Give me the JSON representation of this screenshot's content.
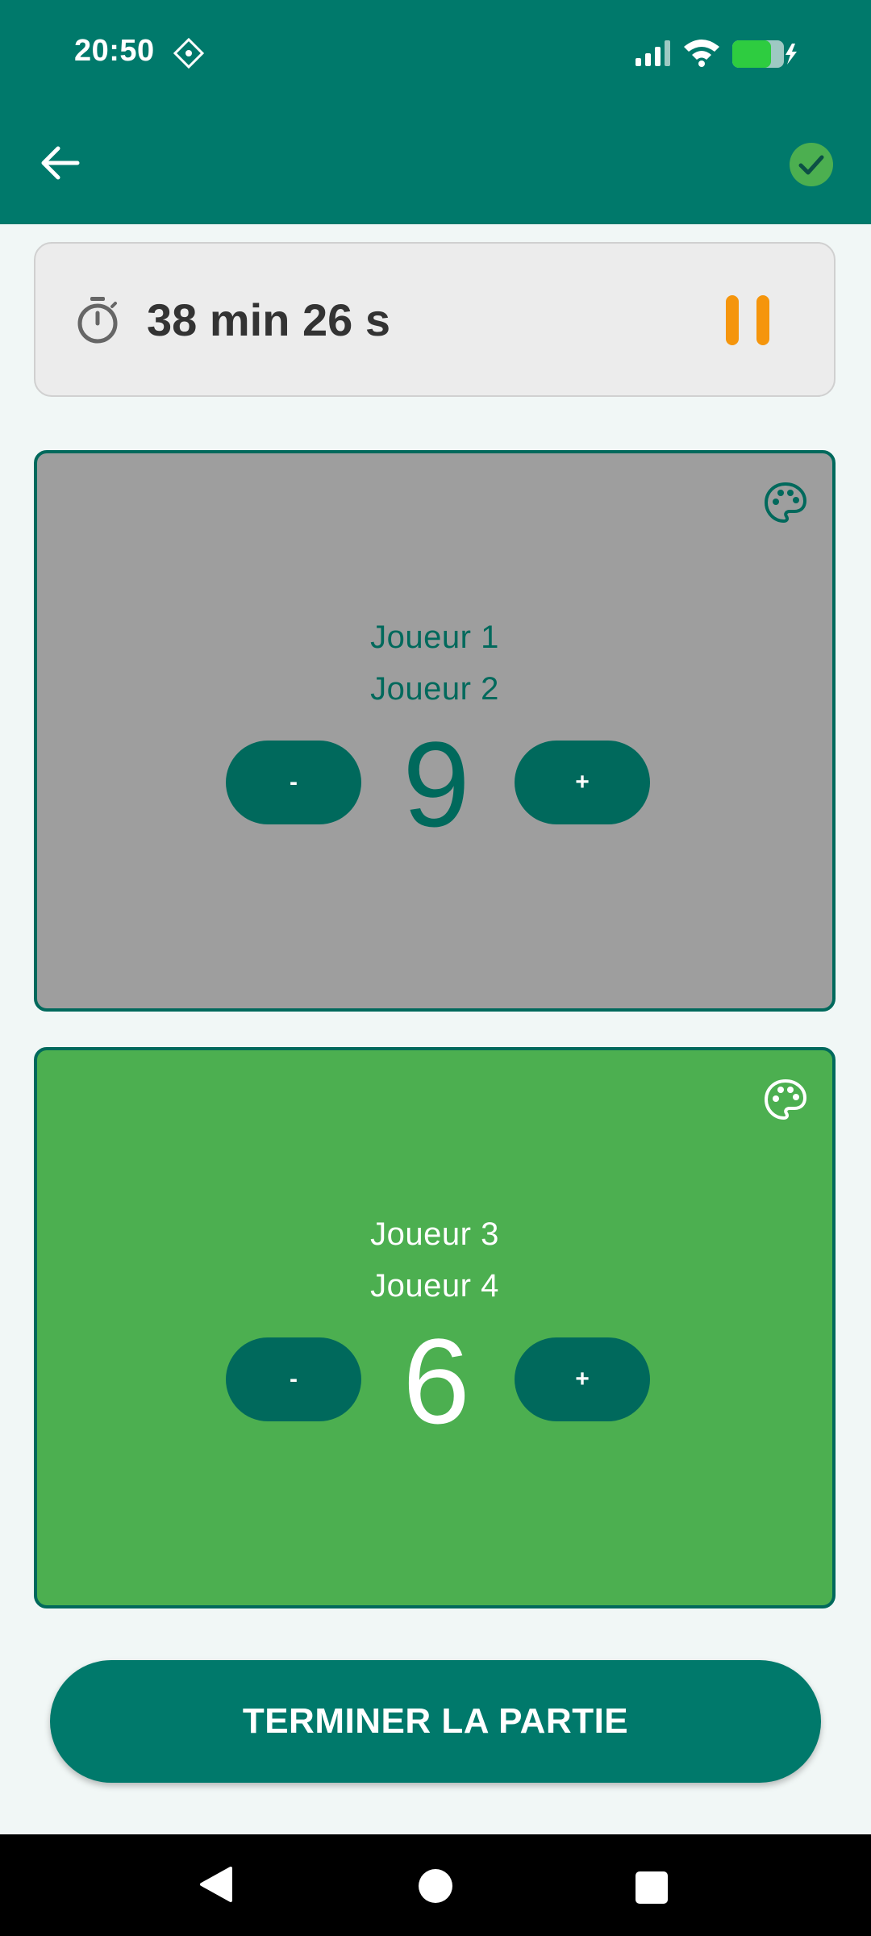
{
  "status_bar": {
    "time": "20:50",
    "icons": [
      "gps-icon",
      "signal-icon",
      "wifi-icon",
      "battery-charging-icon"
    ]
  },
  "app_bar": {
    "back_icon": "arrow-back-icon",
    "confirm_icon": "check-circle-icon"
  },
  "timer": {
    "icon": "stopwatch-icon",
    "elapsed": "38 min 26 s",
    "pause_icon": "pause-icon",
    "pause_color": "#f5950c"
  },
  "teams": [
    {
      "players": [
        "Joueur 1",
        "Joueur 2"
      ],
      "score": "9",
      "minus_label": "-",
      "plus_label": "+",
      "background": "#9e9e9e",
      "text_color": "#00695c",
      "palette_icon": "palette-icon"
    },
    {
      "players": [
        "Joueur 3",
        "Joueur 4"
      ],
      "score": "6",
      "minus_label": "-",
      "plus_label": "+",
      "background": "#4caf50",
      "text_color": "#ffffff",
      "palette_icon": "palette-icon"
    }
  ],
  "finish_button": {
    "label": "TERMINER LA PARTIE"
  },
  "nav_bar": {
    "icons": [
      "nav-back-icon",
      "nav-home-icon",
      "nav-recents-icon"
    ]
  },
  "colors": {
    "primary": "#00796b",
    "primary_dark": "#00695c",
    "accent": "#4caf50",
    "background": "#f1f7f6"
  }
}
